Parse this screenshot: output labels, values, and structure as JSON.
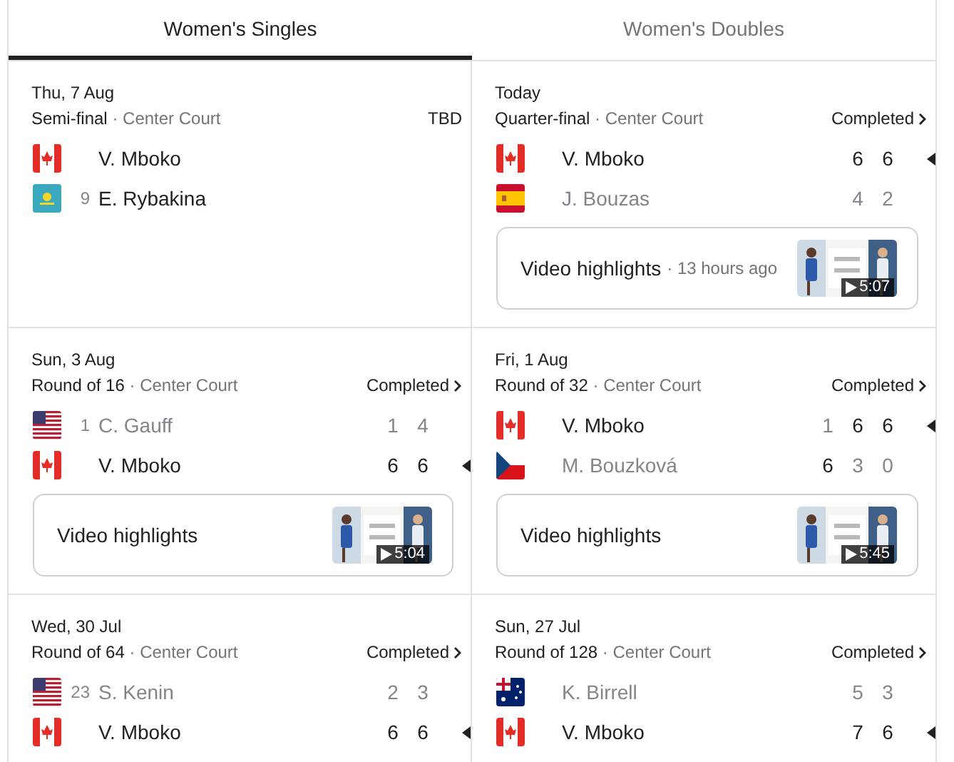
{
  "tabs": [
    {
      "label": "Women's Singles",
      "selected": true
    },
    {
      "label": "Women's Doubles",
      "selected": false
    }
  ],
  "matches": [
    {
      "date": "Thu, 7 Aug",
      "round": "Semi-final",
      "court": "· Center Court",
      "status": "TBD",
      "link": false,
      "players": [
        {
          "kind": "ca",
          "name": "V. Mboko",
          "lost": false
        },
        {
          "kind": "kz",
          "seed": "9",
          "name": "E. Rybakina",
          "lost": false
        }
      ]
    },
    {
      "date": "Today",
      "round": "Quarter-final",
      "court": "· Center Court",
      "status": "Completed",
      "link": true,
      "players": [
        {
          "kind": "ca",
          "name": "V. Mboko",
          "winner": true,
          "lost": false,
          "scores": [
            {
              "value": "6",
              "won": true
            },
            {
              "value": "6",
              "won": true
            }
          ]
        },
        {
          "kind": "es",
          "name": "J. Bouzas",
          "winner": false,
          "lost": true,
          "scores": [
            {
              "value": "4",
              "won": false
            },
            {
              "value": "2",
              "won": false
            }
          ]
        }
      ],
      "video": {
        "label": "Video highlights",
        "ago": "· 13 hours ago",
        "duration": "5:07"
      }
    },
    {
      "date": "Sun, 3 Aug",
      "round": "Round of 16",
      "court": "· Center Court",
      "status": "Completed",
      "link": true,
      "players": [
        {
          "kind": "us",
          "seed": "1",
          "name": "C. Gauff",
          "winner": false,
          "lost": true,
          "scores": [
            {
              "value": "1",
              "won": false
            },
            {
              "value": "4",
              "won": false
            }
          ]
        },
        {
          "kind": "ca",
          "name": "V. Mboko",
          "winner": true,
          "lost": false,
          "scores": [
            {
              "value": "6",
              "won": true
            },
            {
              "value": "6",
              "won": true
            }
          ]
        }
      ],
      "video": {
        "label": "Video highlights",
        "duration": "5:04"
      }
    },
    {
      "date": "Fri, 1 Aug",
      "round": "Round of 32",
      "court": "· Center Court",
      "status": "Completed",
      "link": true,
      "players": [
        {
          "kind": "ca",
          "name": "V. Mboko",
          "winner": true,
          "lost": false,
          "scores": [
            {
              "value": "1",
              "won": false
            },
            {
              "value": "6",
              "won": true
            },
            {
              "value": "6",
              "won": true
            }
          ]
        },
        {
          "kind": "cz",
          "name": "M. Bouzková",
          "winner": false,
          "lost": true,
          "scores": [
            {
              "value": "6",
              "won": true
            },
            {
              "value": "3",
              "won": false
            },
            {
              "value": "0",
              "won": false
            }
          ]
        }
      ],
      "video": {
        "label": "Video highlights",
        "duration": "5:45"
      }
    },
    {
      "date": "Wed, 30 Jul",
      "round": "Round of 64",
      "court": "· Center Court",
      "status": "Completed",
      "link": true,
      "players": [
        {
          "kind": "us",
          "seed": "23",
          "name": "S. Kenin",
          "winner": false,
          "lost": true,
          "scores": [
            {
              "value": "2",
              "won": false
            },
            {
              "value": "3",
              "won": false
            }
          ]
        },
        {
          "kind": "ca",
          "name": "V. Mboko",
          "winner": true,
          "lost": false,
          "scores": [
            {
              "value": "6",
              "won": true
            },
            {
              "value": "6",
              "won": true
            }
          ]
        }
      ]
    },
    {
      "date": "Sun, 27 Jul",
      "round": "Round of 128",
      "court": "· Center Court",
      "status": "Completed",
      "link": true,
      "players": [
        {
          "kind": "au",
          "name": "K. Birrell",
          "winner": false,
          "lost": true,
          "scores": [
            {
              "value": "5",
              "won": false
            },
            {
              "value": "3",
              "won": false
            }
          ]
        },
        {
          "kind": "ca",
          "name": "V. Mboko",
          "winner": true,
          "lost": false,
          "scores": [
            {
              "value": "7",
              "won": true
            },
            {
              "value": "6",
              "won": true
            }
          ]
        }
      ]
    }
  ]
}
